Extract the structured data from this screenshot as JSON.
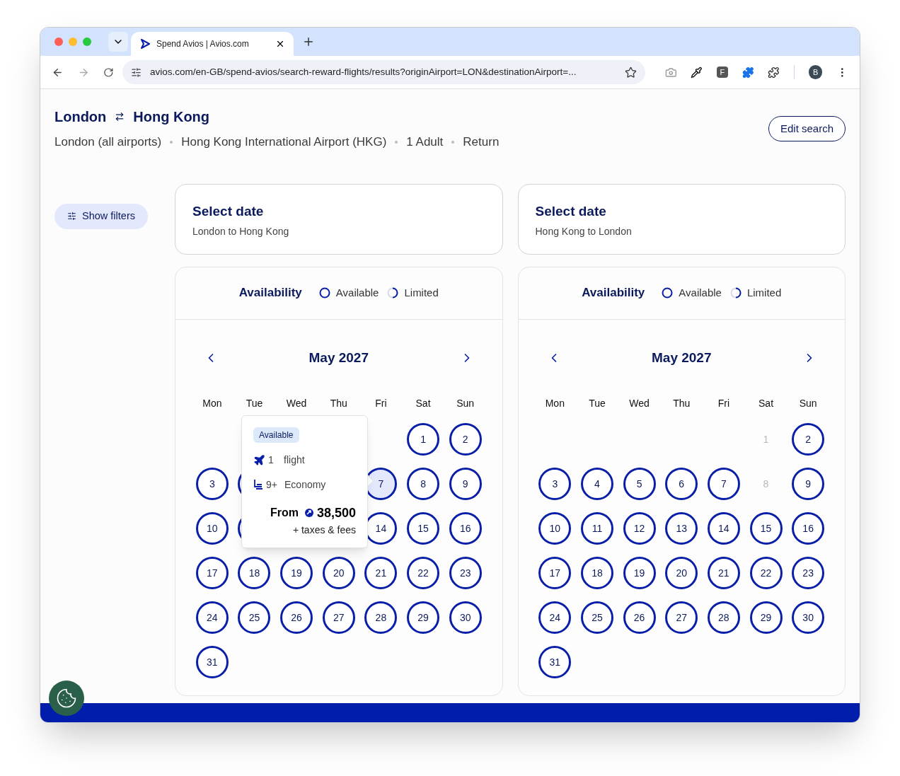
{
  "browser": {
    "tab_title": "Spend Avios | Avios.com",
    "url": "avios.com/en-GB/spend-avios/search-reward-flights/results?originAirport=LON&destinationAirport=...",
    "extension_letter": "F",
    "profile_letter": "B"
  },
  "header": {
    "origin": "London",
    "destination": "Hong Kong",
    "details": [
      "London (all airports)",
      "Hong Kong International Airport (HKG)",
      "1 Adult",
      "Return"
    ],
    "edit_button": "Edit search"
  },
  "filters_button": "Show filters",
  "legs": [
    {
      "title": "Select date",
      "subtitle": "London to Hong Kong",
      "legend_title": "Availability",
      "legend": [
        {
          "label": "Available",
          "kind": "full"
        },
        {
          "label": "Limited",
          "kind": "partial"
        }
      ],
      "month": "May 2027",
      "weekdays": [
        "Mon",
        "Tue",
        "Wed",
        "Thu",
        "Fri",
        "Sat",
        "Sun"
      ],
      "days": [
        {
          "kind": "empty"
        },
        {
          "kind": "empty"
        },
        {
          "kind": "empty"
        },
        {
          "kind": "empty"
        },
        {
          "kind": "empty"
        },
        {
          "kind": "available",
          "label": "1",
          "selected": false
        },
        {
          "kind": "available",
          "label": "2",
          "selected": false
        },
        {
          "kind": "available",
          "label": "3",
          "selected": false
        },
        {
          "kind": "covered"
        },
        {
          "kind": "empty"
        },
        {
          "kind": "empty"
        },
        {
          "kind": "available",
          "label": "7",
          "selected": true
        },
        {
          "kind": "available",
          "label": "8",
          "selected": false
        },
        {
          "kind": "available",
          "label": "9",
          "selected": false
        },
        {
          "kind": "available",
          "label": "10",
          "selected": false
        },
        {
          "kind": "covered"
        },
        {
          "kind": "empty"
        },
        {
          "kind": "empty"
        },
        {
          "kind": "available",
          "label": "14",
          "selected": false
        },
        {
          "kind": "available",
          "label": "15",
          "selected": false
        },
        {
          "kind": "available",
          "label": "16",
          "selected": false
        },
        {
          "kind": "available",
          "label": "17",
          "selected": false
        },
        {
          "kind": "available",
          "label": "18",
          "selected": false
        },
        {
          "kind": "available",
          "label": "19",
          "selected": false
        },
        {
          "kind": "available",
          "label": "20",
          "selected": false
        },
        {
          "kind": "available",
          "label": "21",
          "selected": false
        },
        {
          "kind": "available",
          "label": "22",
          "selected": false
        },
        {
          "kind": "available",
          "label": "23",
          "selected": false
        },
        {
          "kind": "available",
          "label": "24",
          "selected": false
        },
        {
          "kind": "available",
          "label": "25",
          "selected": false
        },
        {
          "kind": "available",
          "label": "26",
          "selected": false
        },
        {
          "kind": "available",
          "label": "27",
          "selected": false
        },
        {
          "kind": "available",
          "label": "28",
          "selected": false
        },
        {
          "kind": "available",
          "label": "29",
          "selected": false
        },
        {
          "kind": "available",
          "label": "30",
          "selected": false
        },
        {
          "kind": "available",
          "label": "31",
          "selected": false
        }
      ],
      "tooltip": {
        "badge": "Available",
        "flights_count": "1",
        "flights_label": "flight",
        "seats_count": "9+",
        "cabin": "Economy",
        "from_label": "From",
        "price": "38,500",
        "fees": "+ taxes & fees"
      }
    },
    {
      "title": "Select date",
      "subtitle": "Hong Kong to London",
      "legend_title": "Availability",
      "legend": [
        {
          "label": "Available",
          "kind": "full"
        },
        {
          "label": "Limited",
          "kind": "partial"
        }
      ],
      "month": "May 2027",
      "weekdays": [
        "Mon",
        "Tue",
        "Wed",
        "Thu",
        "Fri",
        "Sat",
        "Sun"
      ],
      "days": [
        {
          "kind": "empty"
        },
        {
          "kind": "empty"
        },
        {
          "kind": "empty"
        },
        {
          "kind": "empty"
        },
        {
          "kind": "empty"
        },
        {
          "kind": "unavailable",
          "label": "1",
          "selected": false
        },
        {
          "kind": "available",
          "label": "2",
          "selected": false
        },
        {
          "kind": "available",
          "label": "3",
          "selected": false
        },
        {
          "kind": "available",
          "label": "4",
          "selected": false
        },
        {
          "kind": "available",
          "label": "5",
          "selected": false
        },
        {
          "kind": "available",
          "label": "6",
          "selected": false
        },
        {
          "kind": "available",
          "label": "7",
          "selected": false
        },
        {
          "kind": "unavailable",
          "label": "8",
          "selected": false
        },
        {
          "kind": "available",
          "label": "9",
          "selected": false
        },
        {
          "kind": "available",
          "label": "10",
          "selected": false
        },
        {
          "kind": "available",
          "label": "11",
          "selected": false
        },
        {
          "kind": "available",
          "label": "12",
          "selected": false
        },
        {
          "kind": "available",
          "label": "13",
          "selected": false
        },
        {
          "kind": "available",
          "label": "14",
          "selected": false
        },
        {
          "kind": "available",
          "label": "15",
          "selected": false
        },
        {
          "kind": "available",
          "label": "16",
          "selected": false
        },
        {
          "kind": "available",
          "label": "17",
          "selected": false
        },
        {
          "kind": "available",
          "label": "18",
          "selected": false
        },
        {
          "kind": "available",
          "label": "19",
          "selected": false
        },
        {
          "kind": "available",
          "label": "20",
          "selected": false
        },
        {
          "kind": "available",
          "label": "21",
          "selected": false
        },
        {
          "kind": "available",
          "label": "22",
          "selected": false
        },
        {
          "kind": "available",
          "label": "23",
          "selected": false
        },
        {
          "kind": "available",
          "label": "24",
          "selected": false
        },
        {
          "kind": "available",
          "label": "25",
          "selected": false
        },
        {
          "kind": "available",
          "label": "26",
          "selected": false
        },
        {
          "kind": "available",
          "label": "27",
          "selected": false
        },
        {
          "kind": "available",
          "label": "28",
          "selected": false
        },
        {
          "kind": "available",
          "label": "29",
          "selected": false
        },
        {
          "kind": "available",
          "label": "30",
          "selected": false
        },
        {
          "kind": "available",
          "label": "31",
          "selected": false
        }
      ]
    }
  ]
}
